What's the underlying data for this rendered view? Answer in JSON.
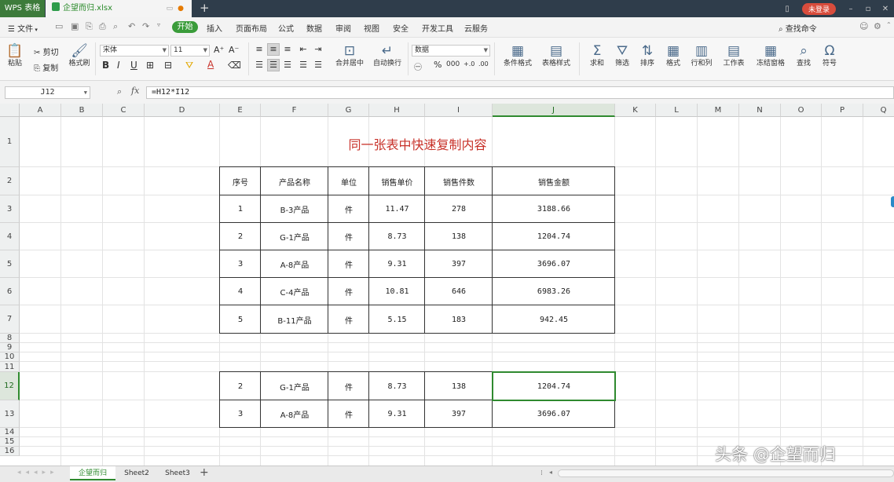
{
  "titlebar": {
    "app_name": "WPS 表格",
    "document_tab": "企望而归.xlsx",
    "new_tab": "+",
    "login": "未登录"
  },
  "menu": {
    "file": "文件",
    "start": "开始",
    "items": [
      "插入",
      "页面布局",
      "公式",
      "数据",
      "审阅",
      "视图",
      "安全",
      "开发工具",
      "云服务"
    ],
    "search": "查找命令"
  },
  "ribbon": {
    "paste": "粘贴",
    "cut": "剪切",
    "copy": "复制",
    "format_painter": "格式刷",
    "font_name": "宋体",
    "font_size": "11",
    "number_format": "数据",
    "merge_center": "合并居中",
    "wrap_text": "自动换行",
    "conditional_format": "条件格式",
    "table_style": "表格样式",
    "sum": "求和",
    "filter": "筛选",
    "sort": "排序",
    "format": "格式",
    "rows_cols": "行和列",
    "worksheet": "工作表",
    "freeze": "冻结窗格",
    "find": "查找",
    "symbol": "符号",
    "bold": "B",
    "italic": "I",
    "underline": "U",
    "font_color": "A",
    "percent": "%",
    "thousands": "000"
  },
  "formula_bar": {
    "name_box": "J12",
    "fx": "fx",
    "formula": "=H12*I12"
  },
  "columns": [
    "A",
    "B",
    "C",
    "D",
    "E",
    "F",
    "G",
    "H",
    "I",
    "J",
    "K",
    "L",
    "M",
    "N",
    "O",
    "P",
    "Q"
  ],
  "rows": [
    "1",
    "2",
    "3",
    "4",
    "5",
    "6",
    "7",
    "8",
    "9",
    "10",
    "11",
    "12",
    "13",
    "14",
    "15",
    "16"
  ],
  "sheet": {
    "title": "同一张表中快速复制内容",
    "headers": [
      "序号",
      "产品名称",
      "单位",
      "销售单价",
      "销售件数",
      "销售金额"
    ],
    "main_rows": [
      [
        "1",
        "B-3产品",
        "件",
        "11.47",
        "278",
        "3188.66"
      ],
      [
        "2",
        "G-1产品",
        "件",
        "8.73",
        "138",
        "1204.74"
      ],
      [
        "3",
        "A-8产品",
        "件",
        "9.31",
        "397",
        "3696.07"
      ],
      [
        "4",
        "C-4产品",
        "件",
        "10.81",
        "646",
        "6983.26"
      ],
      [
        "5",
        "B-11产品",
        "件",
        "5.15",
        "183",
        "942.45"
      ]
    ],
    "copied_rows": [
      [
        "2",
        "G-1产品",
        "件",
        "8.73",
        "138",
        "1204.74"
      ],
      [
        "3",
        "A-8产品",
        "件",
        "9.31",
        "397",
        "3696.07"
      ]
    ]
  },
  "sheet_tabs": [
    "企望而归",
    "Sheet2",
    "Sheet3"
  ],
  "watermark": "头条 @企望而归",
  "colors": {
    "accent_green": "#2f8a2f",
    "title_red": "#c8322a",
    "titlebar_bg": "#2f3d4b"
  }
}
